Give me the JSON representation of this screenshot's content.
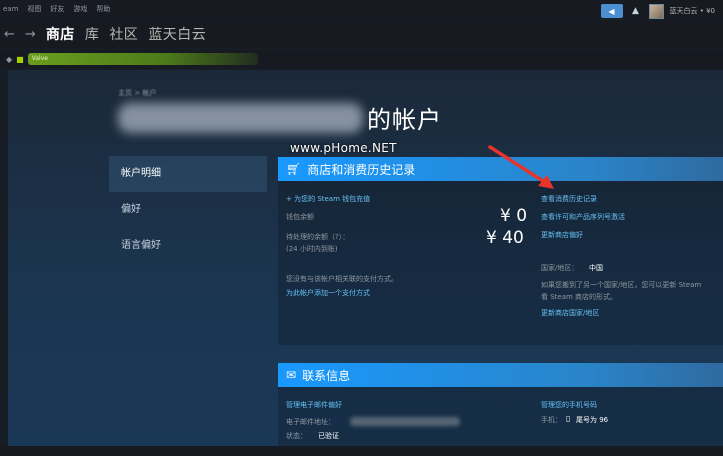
{
  "menubar": {
    "items": [
      "eam",
      "视图",
      "好友",
      "游戏",
      "帮助"
    ]
  },
  "topright": {
    "username": "蓝天白云 • ¥0"
  },
  "nav": {
    "tabs": [
      "商店",
      "库",
      "社区",
      "蓝天白云"
    ]
  },
  "url": {
    "text": "Valve"
  },
  "page": {
    "breadcrumb": "主页 > 帐户",
    "title_suffix": "的帐户"
  },
  "sidebar": {
    "items": [
      {
        "label": "帐户明细",
        "active": true
      },
      {
        "label": "偏好",
        "active": false
      },
      {
        "label": "语言偏好",
        "active": false
      }
    ]
  },
  "history": {
    "title": "商店和消费历史记录",
    "add_funds": "+ 为您的 Steam 钱包充值",
    "wallet_label": "钱包余额",
    "wallet_amount": "¥ 0",
    "pending_label": "待处理的余额（?）：",
    "pending_note": "(24 小时内到账)",
    "pending_amount": "¥ 40",
    "no_payment": "您没有与该帐户相关联的支付方式。",
    "add_payment": "为此帐户添加一个支付方式",
    "view_history": "查看消费历史记录",
    "view_licenses": "查看许可和产品序列号激活",
    "change_prefs": "更新商店偏好",
    "country_label": "国家/地区：",
    "country_value": "中国",
    "country_note_1": "如果您搬到了另一个国家/地区，您可以更新 Steam",
    "country_note_2": "看 Steam 商店的形式。",
    "update_country": "更新商店国家/地区"
  },
  "contact": {
    "title": "联系信息",
    "manage_email": "管理电子邮件偏好",
    "email_label": "电子邮件地址：",
    "status_label": "状态：",
    "status_value": "已验证",
    "manage_phone": "管理您的手机号码",
    "phone_label": "手机：",
    "phone_value": "尾号为 96"
  },
  "watermark": "www.pHome.NET",
  "colors": {
    "accent": "#67c1f5",
    "header_blue": "#1999ff",
    "arrow": "#e8342a",
    "bg": "#1b2838"
  }
}
